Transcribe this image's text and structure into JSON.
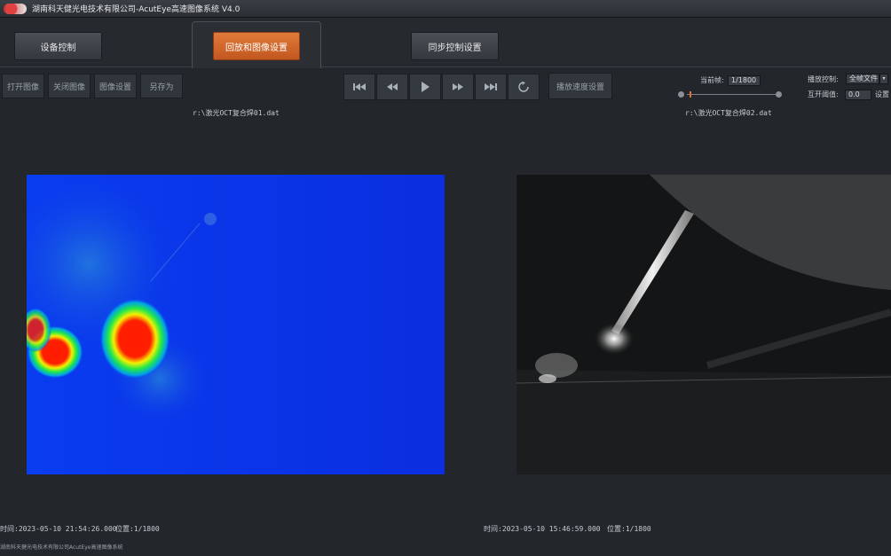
{
  "titlebar": {
    "title": "湖南科天健光电技术有限公司-AcutEye高速图像系统 V4.0"
  },
  "tabs": [
    {
      "label": "设备控制",
      "active": false
    },
    {
      "label": "回放和图像设置",
      "active": true
    },
    {
      "label": "同步控制设置",
      "active": false
    }
  ],
  "toolbar": {
    "file_buttons": [
      "打开图像",
      "关闭图像",
      "图像设置",
      "另存为"
    ],
    "playback_speed_label": "播放速度设置",
    "current_frame_label": "当前帧:",
    "current_frame_value": "1/1800",
    "play_control_label": "播放控制:",
    "play_control_value": "全帧文件",
    "threshold_label": "互开阈值:",
    "threshold_value": "0.0",
    "settings_label": "设置"
  },
  "left_view": {
    "file_path": "r:\\激光OCT复合焊01.dat",
    "time": "时间:2023-05-10 21:54:26.000",
    "position": "位置:1/1800"
  },
  "right_view": {
    "file_path": "r:\\激光OCT复合焊02.dat",
    "time": "时间:2023-05-10 15:46:59.000",
    "position": "位置:1/1800"
  },
  "footer": {
    "text": "湖南科天健光电技术有限公司AcutEye高速图像系统"
  },
  "colors": {
    "accent": "#d2642a",
    "background": "#23272c",
    "thermal_bg": "#0a32e8"
  }
}
